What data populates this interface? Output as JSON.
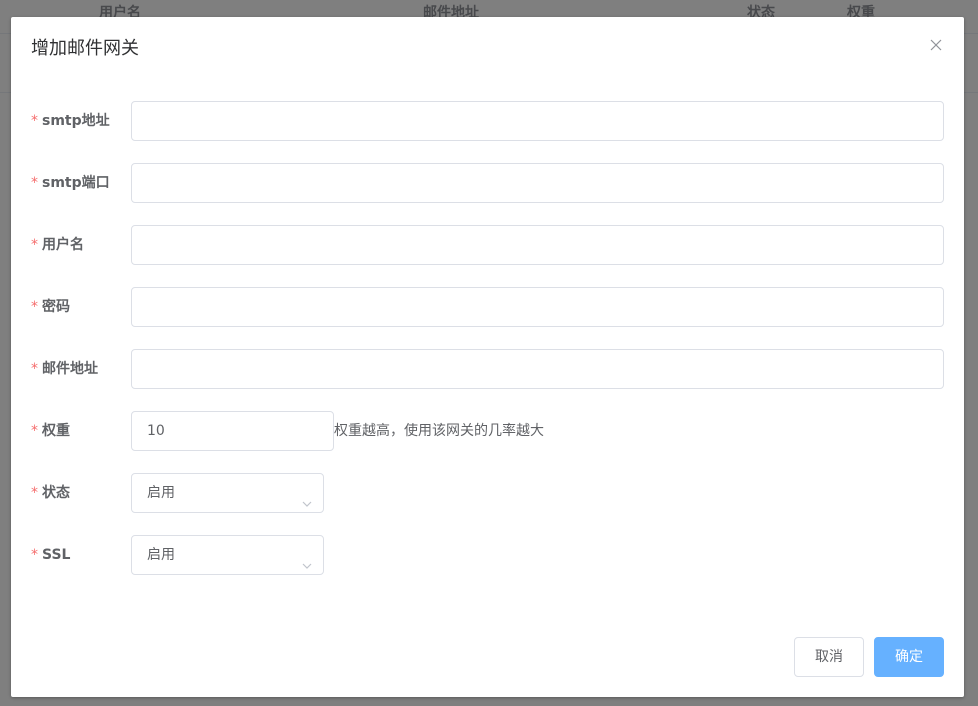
{
  "background_table": {
    "headers": [
      "用户名",
      "邮件地址",
      "状态",
      "权重"
    ]
  },
  "dialog": {
    "title": "增加邮件网关",
    "close_icon": "close-icon",
    "fields": {
      "smtp_address": {
        "label": "smtp地址",
        "value": "",
        "required": "*"
      },
      "smtp_port": {
        "label": "smtp端口",
        "value": "",
        "required": "*"
      },
      "username": {
        "label": "用户名",
        "value": "",
        "required": "*"
      },
      "password": {
        "label": "密码",
        "value": "",
        "required": "*"
      },
      "email": {
        "label": "邮件地址",
        "value": "",
        "required": "*"
      },
      "weight": {
        "label": "权重",
        "value": "10",
        "hint": "权重越高，使用该网关的几率越大",
        "required": "*"
      },
      "status": {
        "label": "状态",
        "selected": "启用",
        "required": "*"
      },
      "ssl": {
        "label": "SSL",
        "selected": "启用",
        "required": "*"
      }
    },
    "buttons": {
      "cancel": "取消",
      "confirm": "确定"
    }
  },
  "colors": {
    "primary": "#66b1ff",
    "required": "#f56c6c",
    "border": "#dcdfe6",
    "text": "#606266",
    "title": "#303133"
  }
}
